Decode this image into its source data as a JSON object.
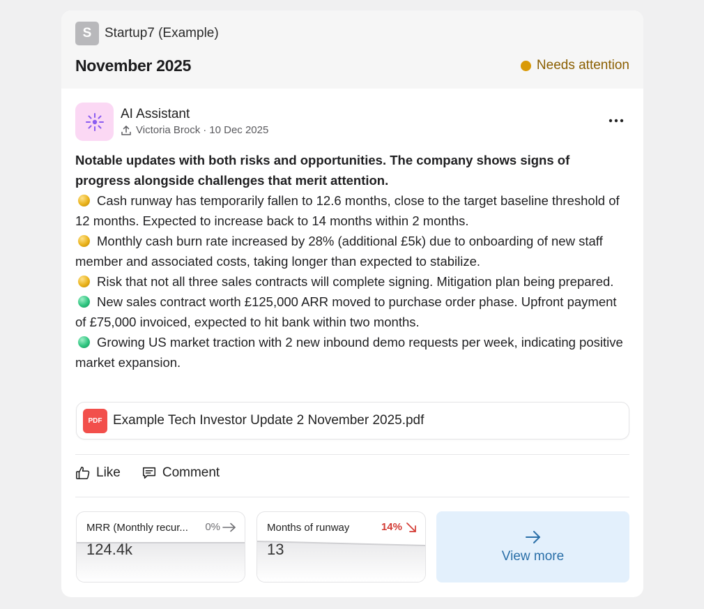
{
  "company": {
    "avatar_letter": "S",
    "name": "Startup7 (Example)"
  },
  "period": "November 2025",
  "status": {
    "label": "Needs attention",
    "color": "#d99a07"
  },
  "post": {
    "author": "AI Assistant",
    "uploader": "Victoria Brock",
    "separator": "·",
    "date": "10 Dec 2025",
    "avatar_icon": "sparkle-icon",
    "menu_icon": "more-horizontal-icon"
  },
  "summary": {
    "lead": "Notable updates with both risks and opportunities. The company shows signs of progress alongside challenges that merit attention.",
    "bullets": [
      {
        "tone": "amber",
        "text": "Cash runway has temporarily fallen to 12.6 months, close to the target baseline threshold of 12 months. Expected to increase back to 14 months within 2 months."
      },
      {
        "tone": "amber",
        "text": "Monthly cash burn rate increased by 28% (additional £5k) due to onboarding of new staff member and associated costs, taking longer than expected to stabilize."
      },
      {
        "tone": "amber",
        "text": "Risk that not all three sales contracts will complete signing. Mitigation plan being prepared."
      },
      {
        "tone": "green",
        "text": "New sales contract worth £125,000 ARR moved to purchase order phase. Upfront payment of £75,000 invoiced, expected to hit bank within two months."
      },
      {
        "tone": "green",
        "text": "Growing US market traction with 2 new inbound demo requests per week, indicating positive market expansion."
      }
    ]
  },
  "attachment": {
    "badge": "PDF",
    "filename": "Example Tech Investor Update 2 November 2025.pdf"
  },
  "actions": {
    "like": "Like",
    "comment": "Comment"
  },
  "metrics": [
    {
      "label": "MRR (Monthly recur...",
      "change": "0%",
      "trend": "flat",
      "value": "124.4k"
    },
    {
      "label": "Months of runway",
      "change": "14%",
      "trend": "down",
      "value": "13"
    }
  ],
  "view_more": {
    "label": "View more"
  },
  "colors": {
    "accent": "#2a6fa8",
    "negative": "#d33a33",
    "pdf": "#f24f4b",
    "ai_avatar_bg": "#fbd8f4"
  }
}
